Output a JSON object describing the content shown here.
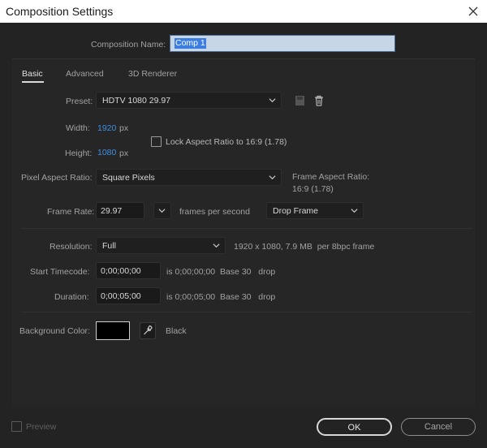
{
  "window": {
    "title": "Composition Settings"
  },
  "composition_name": {
    "label": "Composition Name:",
    "value": "Comp 1"
  },
  "tabs": [
    {
      "label": "Basic",
      "active": true
    },
    {
      "label": "Advanced",
      "active": false
    },
    {
      "label": "3D Renderer",
      "active": false
    }
  ],
  "preset": {
    "label": "Preset:",
    "value": "HDTV 1080 29.97"
  },
  "width": {
    "label": "Width:",
    "value": "1920",
    "unit": "px"
  },
  "height": {
    "label": "Height:",
    "value": "1080",
    "unit": "px"
  },
  "lock_aspect": {
    "label": "Lock Aspect Ratio to 16:9 (1.78)",
    "checked": false
  },
  "pixel_aspect": {
    "label": "Pixel Aspect Ratio:",
    "value": "Square Pixels"
  },
  "frame_aspect": {
    "label": "Frame Aspect Ratio:",
    "value": "16:9 (1.78)"
  },
  "frame_rate": {
    "label": "Frame Rate:",
    "value": "29.97",
    "unit": "frames per second",
    "drop_mode": "Drop Frame"
  },
  "resolution": {
    "label": "Resolution:",
    "value": "Full",
    "info": "1920 x 1080, 7.9 MB  per 8bpc frame"
  },
  "start_timecode": {
    "label": "Start Timecode:",
    "value": "0;00;00;00",
    "info": "is 0;00;00;00  Base 30   drop"
  },
  "duration": {
    "label": "Duration:",
    "value": "0;00;05;00",
    "info": "is 0;00;05;00  Base 30   drop"
  },
  "background": {
    "label": "Background Color:",
    "color_name": "Black",
    "color": "#000000"
  },
  "preview": {
    "label": "Preview",
    "checked": false
  },
  "buttons": {
    "ok": "OK",
    "cancel": "Cancel"
  },
  "colors": {
    "accent": "#3f8fe3",
    "panel": "#262626",
    "dialog": "#232323"
  }
}
